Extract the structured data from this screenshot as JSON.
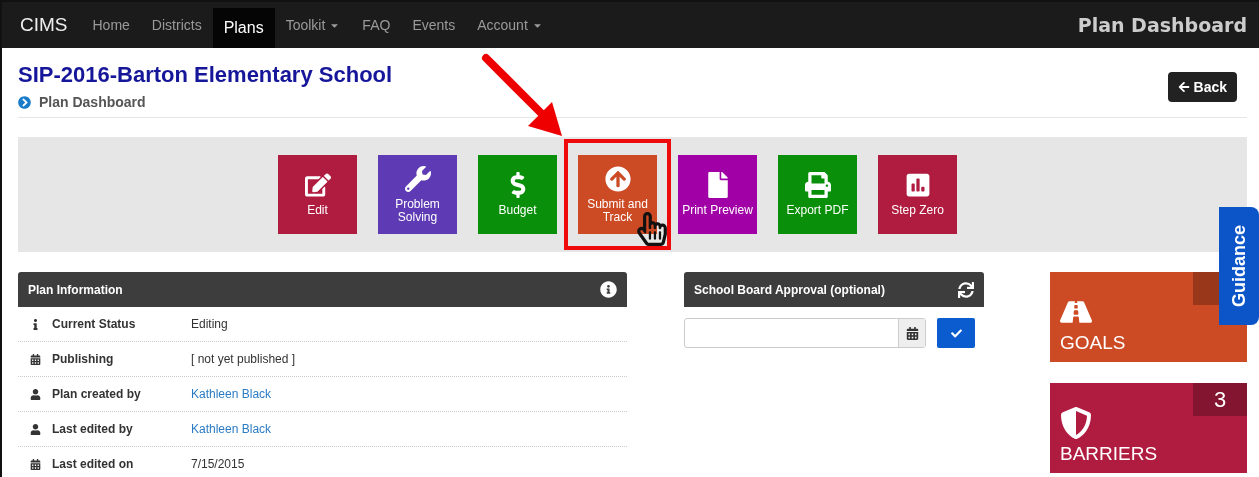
{
  "navbar": {
    "brand": "CIMS",
    "items": [
      {
        "label": "Home",
        "selected": false,
        "dropdown": false
      },
      {
        "label": "Districts",
        "selected": false,
        "dropdown": false
      },
      {
        "label": "Plans",
        "selected": true,
        "dropdown": false
      },
      {
        "label": "Toolkit",
        "selected": false,
        "dropdown": true
      },
      {
        "label": "FAQ",
        "selected": false,
        "dropdown": false
      },
      {
        "label": "Events",
        "selected": false,
        "dropdown": false
      },
      {
        "label": "Account",
        "selected": false,
        "dropdown": true
      }
    ],
    "page_title": "Plan Dashboard"
  },
  "header": {
    "title": "SIP-2016-Barton Elementary School",
    "breadcrumb": "Plan Dashboard",
    "back_button": "Back"
  },
  "actions": [
    {
      "label": "Edit",
      "color": "#b01c40",
      "highlighted": false
    },
    {
      "label": "Problem Solving",
      "color": "#5e3bb4",
      "highlighted": false
    },
    {
      "label": "Budget",
      "color": "#0a8f0a",
      "highlighted": false
    },
    {
      "label": "Submit and Track",
      "color": "#cc4a24",
      "highlighted": true
    },
    {
      "label": "Print Preview",
      "color": "#a100a6",
      "highlighted": false
    },
    {
      "label": "Export PDF",
      "color": "#0a8f0a",
      "highlighted": false
    },
    {
      "label": "Step Zero",
      "color": "#b01c40",
      "highlighted": false
    }
  ],
  "plan_information": {
    "title": "Plan Information",
    "rows": [
      {
        "label": "Current Status",
        "value": "Editing",
        "link": false
      },
      {
        "label": "Publishing",
        "value": "[ not yet published ]",
        "link": false
      },
      {
        "label": "Plan created by",
        "value": "Kathleen Black",
        "link": true
      },
      {
        "label": "Last edited by",
        "value": "Kathleen Black",
        "link": true
      },
      {
        "label": "Last edited on",
        "value": "7/15/2015",
        "link": false
      }
    ]
  },
  "school_board_approval": {
    "title": "School Board Approval (optional)"
  },
  "summary_tiles": [
    {
      "label": "GOALS",
      "color": "#cc4a24"
    },
    {
      "label": "BARRIERS",
      "count": "3",
      "color": "#b01c40"
    }
  ],
  "guidance_tab": "Guidance"
}
